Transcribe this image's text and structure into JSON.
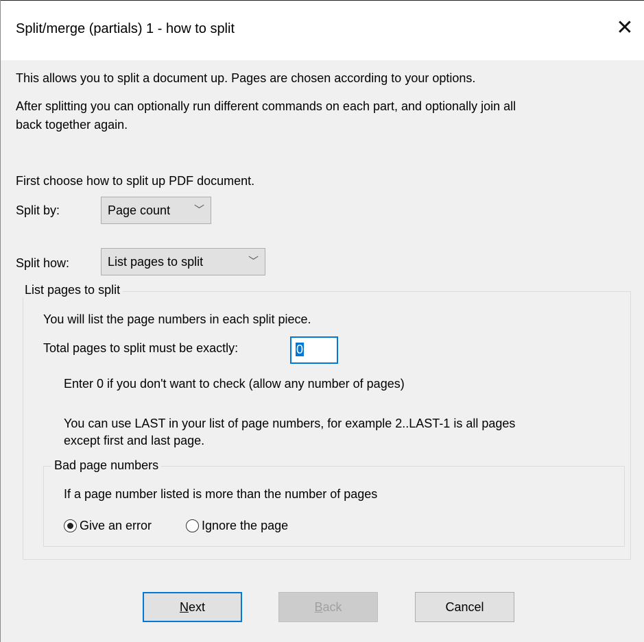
{
  "window": {
    "title": "Split/merge (partials) 1 - how to split",
    "close_glyph": "✕"
  },
  "intro": {
    "line1": "This allows you to split a document up. Pages are chosen according to your options.",
    "line2": "After splitting you can optionally run different commands on each part, and optionally join all",
    "line3": "back together again."
  },
  "choose_prompt": "First choose how to split up PDF document.",
  "split_by": {
    "label": "Split by:",
    "value": "Page count"
  },
  "split_how": {
    "label": "Split how:",
    "value": "List pages to split"
  },
  "list_group": {
    "legend": "List pages to split",
    "description": "You will list the page numbers in each split piece.",
    "total_label": "Total pages to split must be exactly:",
    "total_value": "0",
    "hint_zero": "Enter 0 if you don't want to check (allow any number of pages)",
    "hint_last_1": "You can use LAST in your list of page numbers, for example 2..LAST-1 is all pages",
    "hint_last_2": "except first and last page."
  },
  "bad_group": {
    "legend": "Bad page numbers",
    "description": "If a page number listed is more than the number of pages",
    "options": [
      {
        "label": "Give an error",
        "selected": true
      },
      {
        "label": "Ignore the page",
        "selected": false
      }
    ]
  },
  "buttons": {
    "next": {
      "first": "N",
      "rest": "ext"
    },
    "back": {
      "first": "B",
      "rest": "ack"
    },
    "cancel": "Cancel"
  },
  "colors": {
    "accent": "#0078d7",
    "dialog_bg": "#f0f0f0",
    "button_bg": "#e1e1e1"
  }
}
